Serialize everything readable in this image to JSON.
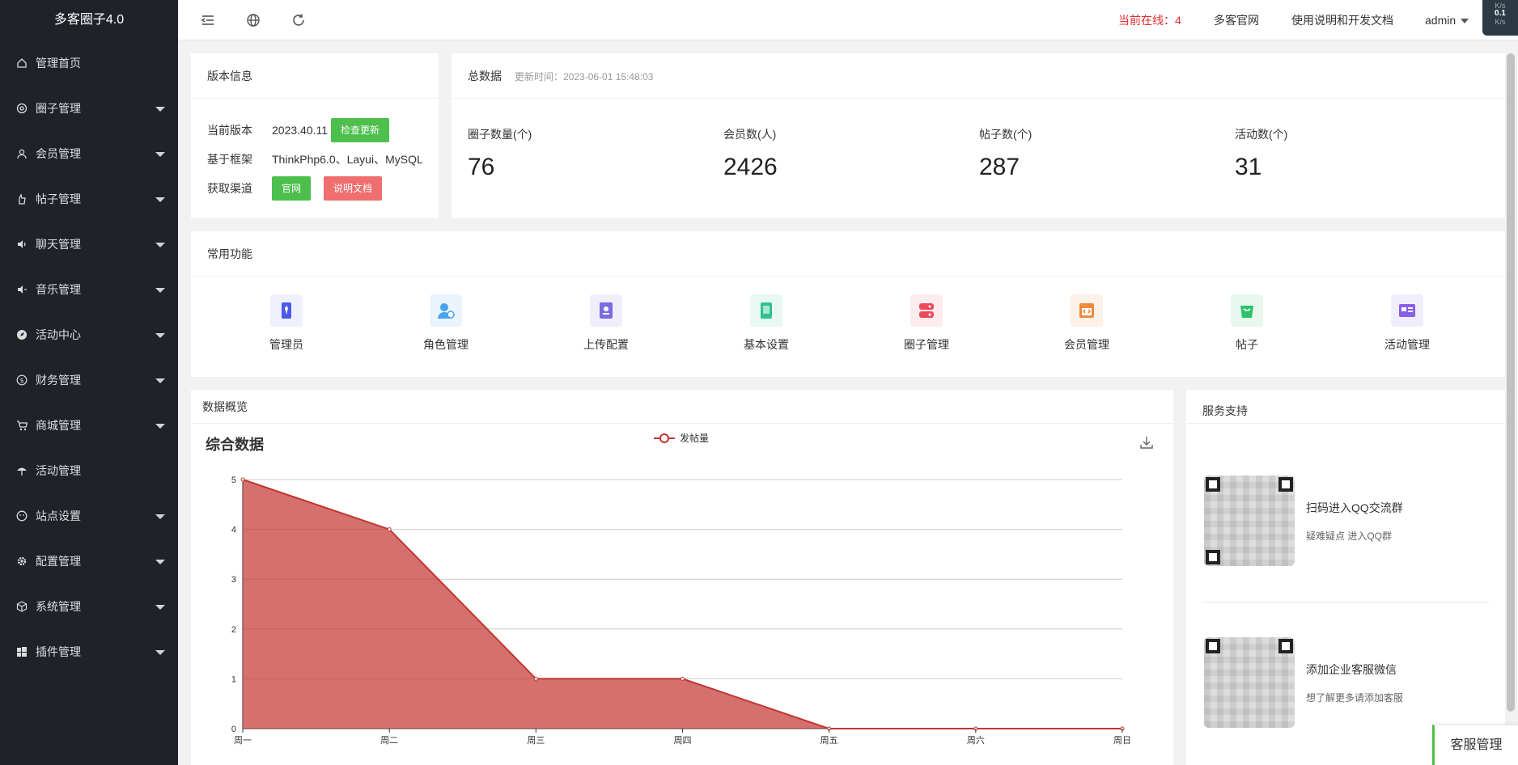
{
  "app": {
    "title": "多客圈子4.0"
  },
  "sidebar": {
    "items": [
      {
        "label": "管理首页",
        "icon": "home-icon",
        "has_children": false
      },
      {
        "label": "圈子管理",
        "icon": "at-icon",
        "has_children": true
      },
      {
        "label": "会员管理",
        "icon": "user-icon",
        "has_children": true
      },
      {
        "label": "帖子管理",
        "icon": "hand-icon",
        "has_children": true
      },
      {
        "label": "聊天管理",
        "icon": "speaker-icon",
        "has_children": true
      },
      {
        "label": "音乐管理",
        "icon": "volume-icon",
        "has_children": true
      },
      {
        "label": "活动中心",
        "icon": "compass-icon",
        "has_children": true
      },
      {
        "label": "财务管理",
        "icon": "dollar-icon",
        "has_children": true
      },
      {
        "label": "商城管理",
        "icon": "cart-icon",
        "has_children": true
      },
      {
        "label": "活动管理",
        "icon": "umbrella-icon",
        "has_children": false
      },
      {
        "label": "站点设置",
        "icon": "face-icon",
        "has_children": true
      },
      {
        "label": "配置管理",
        "icon": "gear-icon",
        "has_children": true
      },
      {
        "label": "系统管理",
        "icon": "cube-icon",
        "has_children": true
      },
      {
        "label": "插件管理",
        "icon": "windows-icon",
        "has_children": true
      }
    ]
  },
  "header": {
    "online_label": "当前在线：",
    "online_count": "4",
    "site_link": "多客官网",
    "docs_link": "使用说明和开发文档",
    "user": "admin",
    "net_up": "K/s",
    "net_speed": "0.1",
    "net_down": "K/s"
  },
  "version": {
    "title": "版本信息",
    "rows": {
      "current_label": "当前版本",
      "current_value": "2023.40.11",
      "check_button": "检查更新",
      "framework_label": "基于框架",
      "framework_value": "ThinkPhp6.0、Layui、MySQL",
      "channel_label": "获取渠道",
      "site_button": "官网",
      "docs_button": "说明文档"
    }
  },
  "totals": {
    "title": "总数据",
    "updated": "更新时间：2023-06-01 15:48:03",
    "stats": [
      {
        "label": "圈子数量(个)",
        "value": "76"
      },
      {
        "label": "会员数(人)",
        "value": "2426"
      },
      {
        "label": "帖子数(个)",
        "value": "287"
      },
      {
        "label": "活动数(个)",
        "value": "31"
      }
    ]
  },
  "common": {
    "title": "常用功能",
    "items": [
      {
        "label": "管理员",
        "icon": "admin-tie-icon",
        "bg": "#eef0fb",
        "fg": "#4a5ae8"
      },
      {
        "label": "角色管理",
        "icon": "role-user-icon",
        "bg": "#eaf4fd",
        "fg": "#4aa3ef"
      },
      {
        "label": "上传配置",
        "icon": "upload-book-icon",
        "bg": "#f0eefb",
        "fg": "#7a6be0"
      },
      {
        "label": "基本设置",
        "icon": "settings-book-icon",
        "bg": "#e8f8f2",
        "fg": "#2fc18f"
      },
      {
        "label": "圈子管理",
        "icon": "circle-server-icon",
        "bg": "#fdecee",
        "fg": "#ef4a5a"
      },
      {
        "label": "会员管理",
        "icon": "member-code-icon",
        "bg": "#fdf1e8",
        "fg": "#f08a3c"
      },
      {
        "label": "帖子",
        "icon": "post-bag-icon",
        "bg": "#e8f8ee",
        "fg": "#2cc26a"
      },
      {
        "label": "活动管理",
        "icon": "activity-card-icon",
        "bg": "#f1eefc",
        "fg": "#8a5fe8"
      }
    ]
  },
  "overview": {
    "title": "数据概览"
  },
  "chart_data": {
    "type": "area",
    "title": "综合数据",
    "categories": [
      "周一",
      "周二",
      "周三",
      "周四",
      "周五",
      "周六",
      "周日"
    ],
    "series": [
      {
        "name": "发帖量",
        "values": [
          5,
          4,
          1,
          1,
          0,
          0,
          0
        ]
      }
    ],
    "ylim": [
      0,
      5
    ],
    "yticks": [
      "0",
      "1",
      "2",
      "3",
      "4",
      "5"
    ],
    "grid": true,
    "legend": "top-center",
    "color": "#c23531"
  },
  "service": {
    "title": "服务支持",
    "items": [
      {
        "title": "扫码进入QQ交流群",
        "sub": "疑难疑点 进入QQ群"
      },
      {
        "title": "添加企业客服微信",
        "sub": "想了解更多请添加客服"
      }
    ]
  },
  "float": {
    "label": "客服管理"
  }
}
